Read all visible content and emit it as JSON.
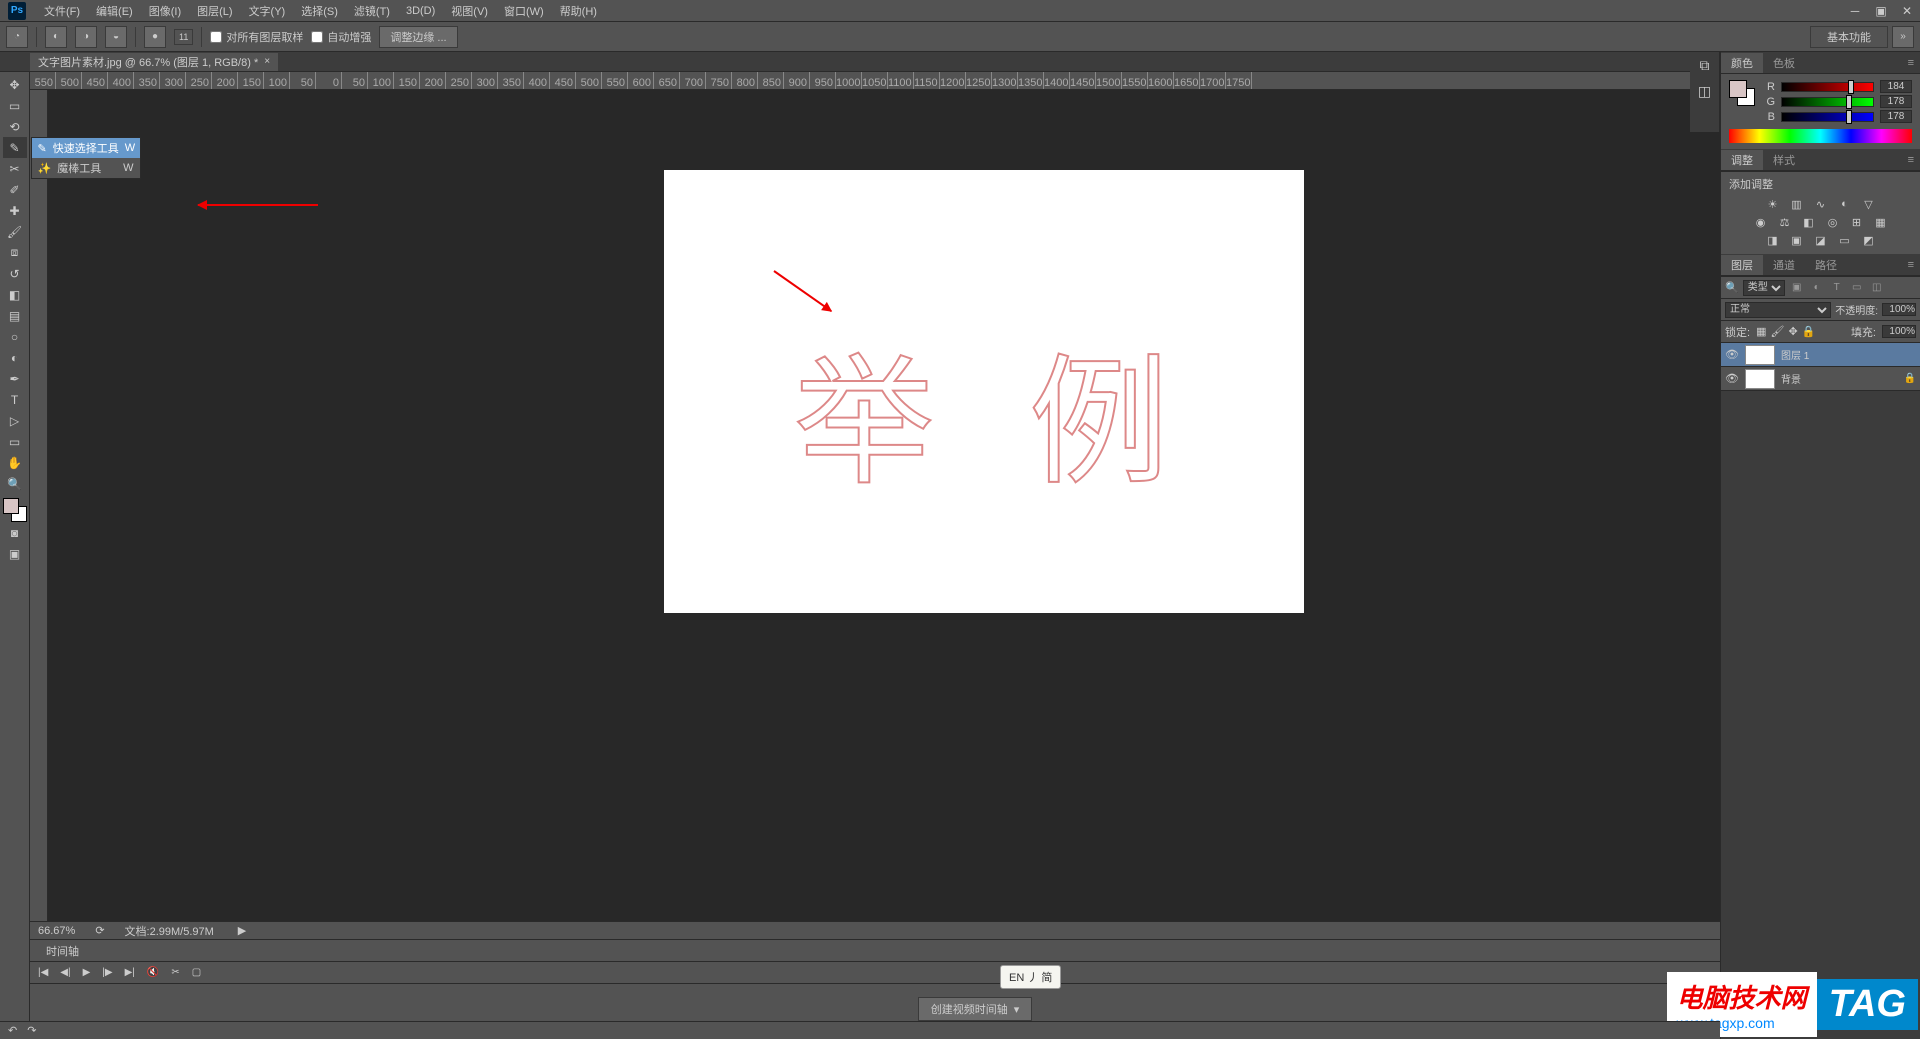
{
  "app": {
    "logo": "Ps"
  },
  "menu": {
    "file": "文件(F)",
    "edit": "编辑(E)",
    "image": "图像(I)",
    "layer": "图层(L)",
    "type": "文字(Y)",
    "select": "选择(S)",
    "filter": "滤镜(T)",
    "threed": "3D(D)",
    "view": "视图(V)",
    "window": "窗口(W)",
    "help": "帮助(H)"
  },
  "options": {
    "brush_size": "11",
    "sample_all": "对所有图层取样",
    "auto_enhance": "自动增强",
    "refine_edge": "调整边缘 ...",
    "essentials": "基本功能"
  },
  "document": {
    "tab_title": "文字图片素材.jpg @ 66.7% (图层 1, RGB/8) *",
    "canvas_text": "举 例"
  },
  "tool_flyout": {
    "quick_select": "快速选择工具",
    "quick_select_key": "W",
    "magic_wand": "魔棒工具",
    "magic_wand_key": "W"
  },
  "ruler": {
    "marks": [
      "550",
      "500",
      "450",
      "400",
      "350",
      "300",
      "250",
      "200",
      "150",
      "100",
      "50",
      "0",
      "50",
      "100",
      "150",
      "200",
      "250",
      "300",
      "350",
      "400",
      "450",
      "500",
      "550",
      "600",
      "650",
      "700",
      "750",
      "800",
      "850",
      "900",
      "950",
      "1000",
      "1050",
      "1100",
      "1150",
      "1200",
      "1250",
      "1300",
      "1350",
      "1400",
      "1450",
      "1500",
      "1550",
      "1600",
      "1650",
      "1700",
      "1750"
    ]
  },
  "status": {
    "zoom": "66.67%",
    "doc_size": "文档:2.99M/5.97M"
  },
  "timeline": {
    "tab": "时间轴",
    "create_btn": "创建视频时间轴"
  },
  "panels": {
    "color_tab": "颜色",
    "swatches_tab": "色板",
    "r_label": "R",
    "r_val": "184",
    "g_label": "G",
    "g_val": "178",
    "b_label": "B",
    "b_val": "178",
    "adjust_tab": "调整",
    "styles_tab": "样式",
    "add_adjust": "添加调整",
    "layers_tab": "图层",
    "channels_tab": "通道",
    "paths_tab": "路径",
    "kind": "类型",
    "blend_mode": "正常",
    "opacity_label": "不透明度:",
    "opacity_val": "100%",
    "lock_label": "锁定:",
    "fill_label": "填充:",
    "fill_val": "100%",
    "layer1_name": "图层 1",
    "bg_layer_name": "背景"
  },
  "ime": {
    "text": "EN 丿 简"
  },
  "watermark": {
    "line1": "电脑技术网",
    "line2": "www.tagxp.com",
    "tag": "TAG"
  }
}
